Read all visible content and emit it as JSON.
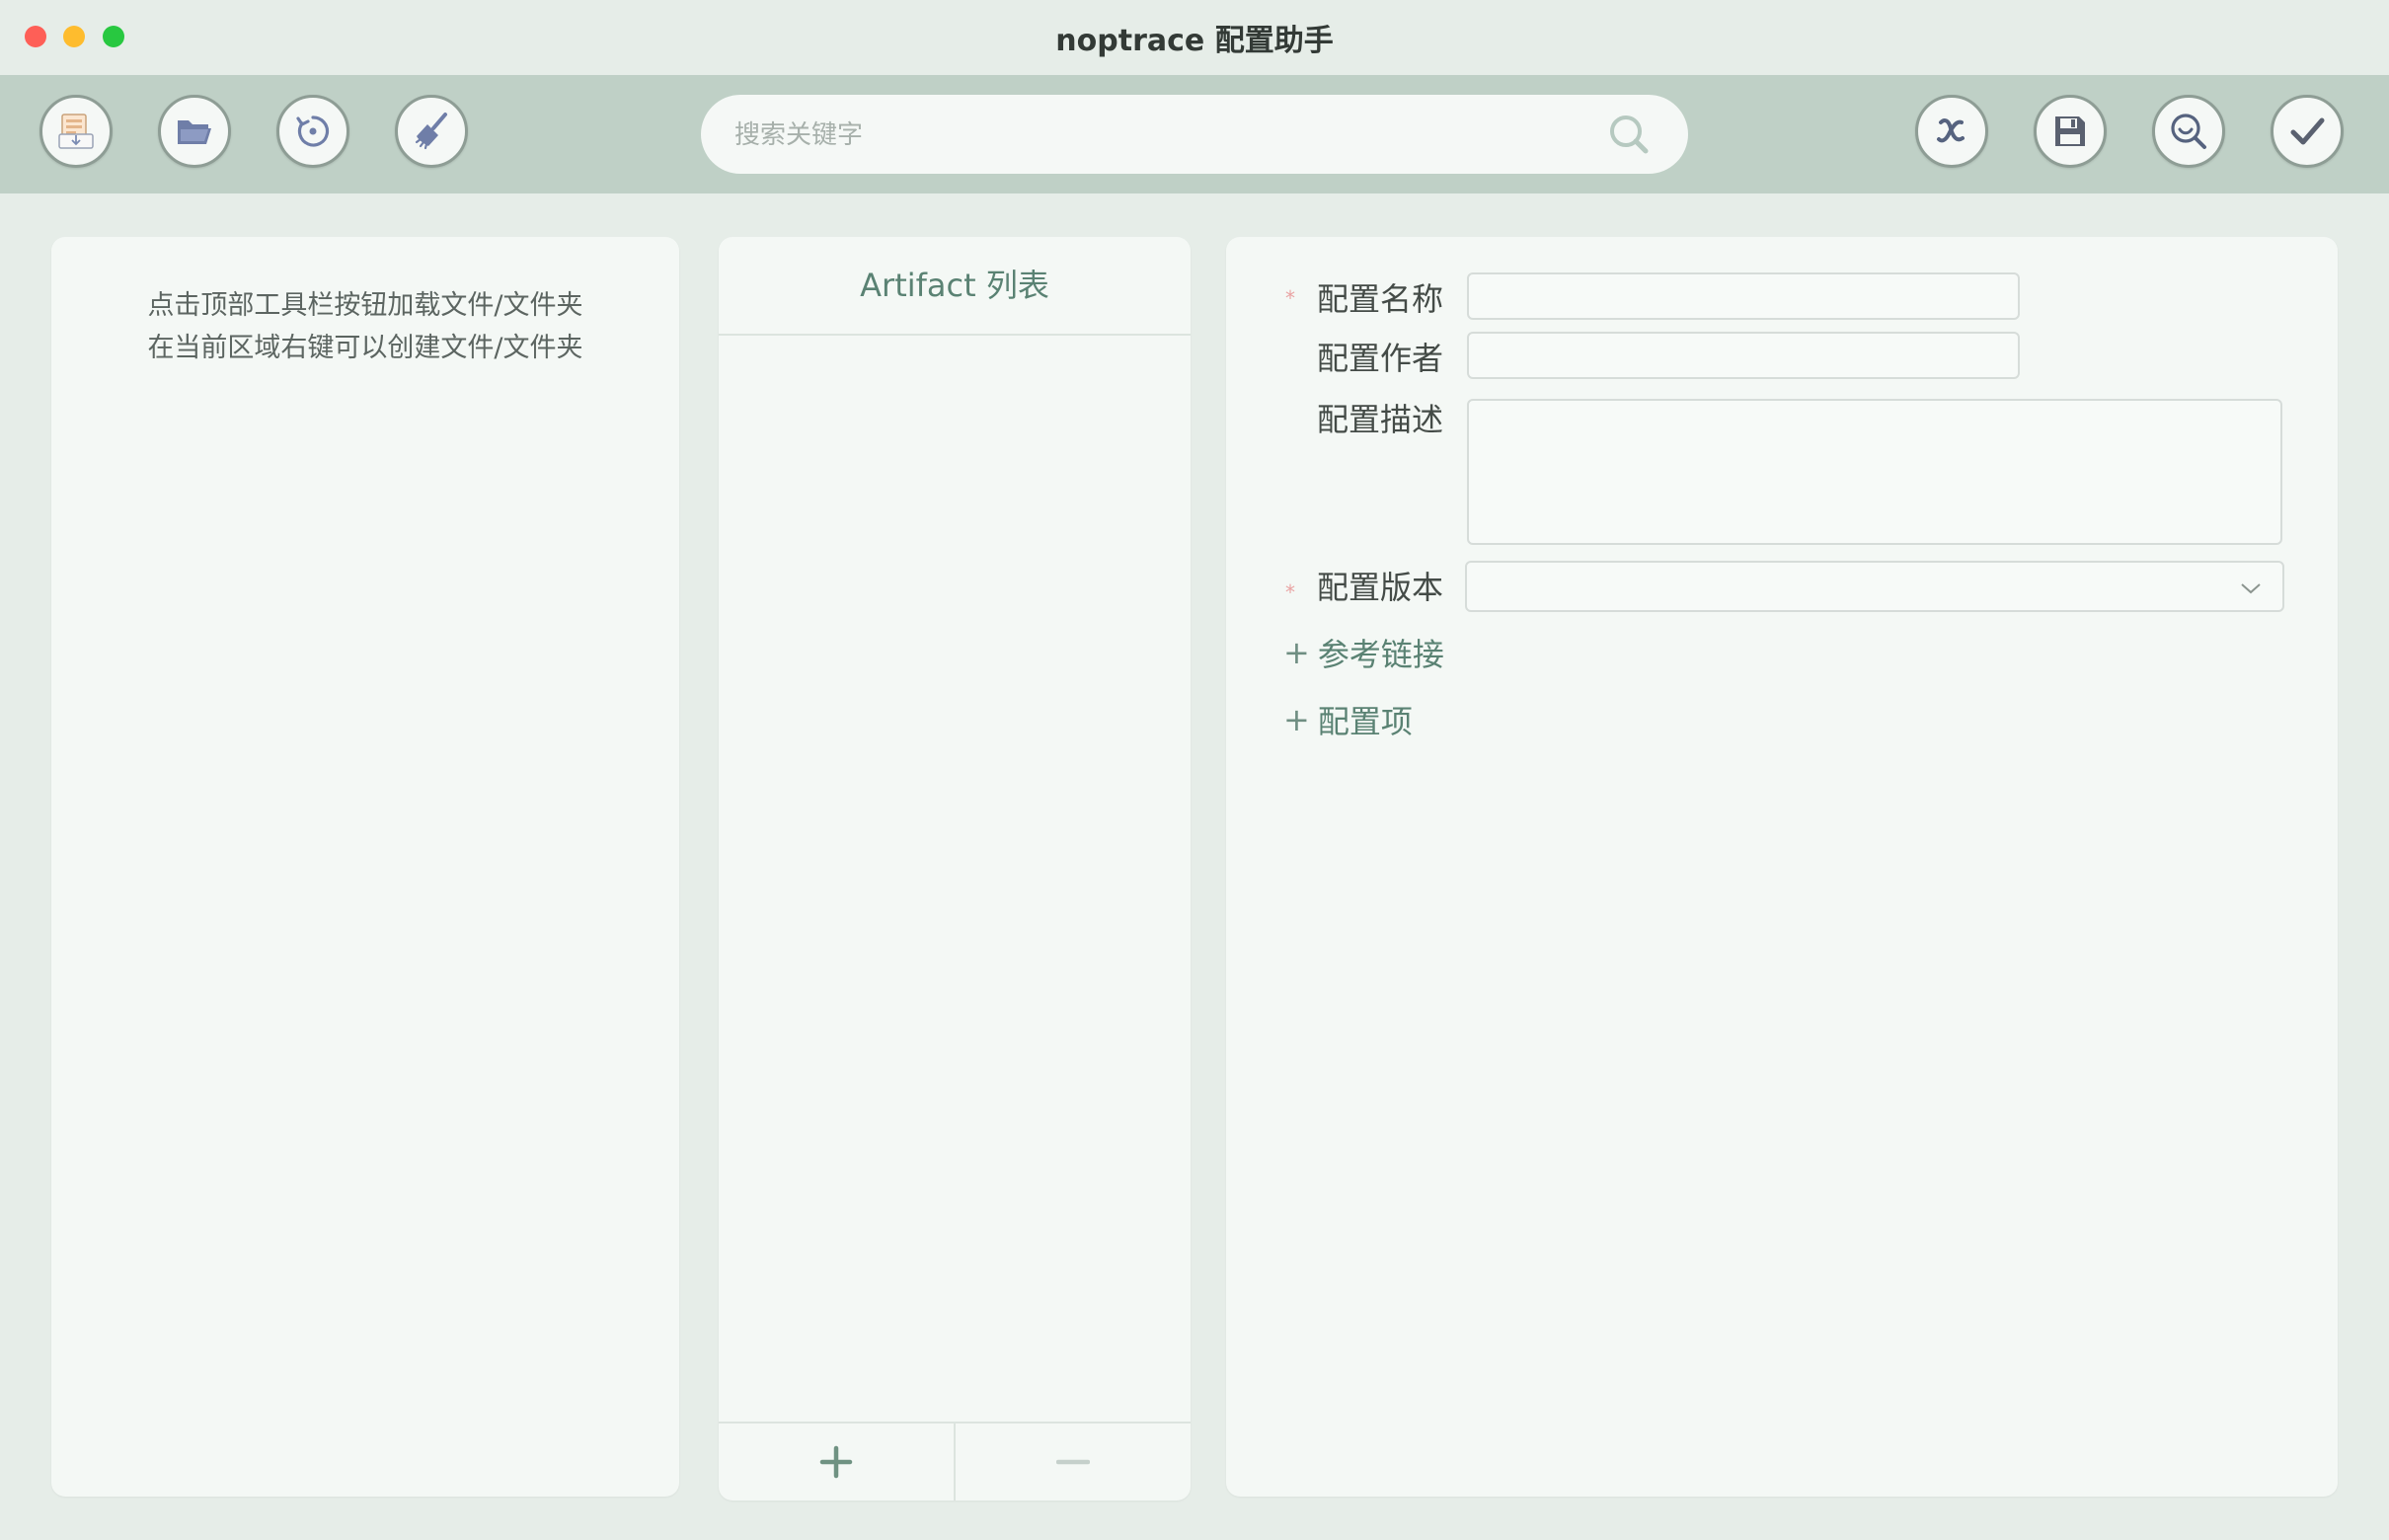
{
  "window": {
    "title": "noptrace 配置助手"
  },
  "toolbar": {
    "search_placeholder": "搜索关键字",
    "left_buttons": [
      "import-file-icon",
      "open-folder-icon",
      "reload-icon",
      "clean-broom-icon"
    ],
    "right_buttons": [
      "variable-x-icon",
      "save-disk-icon",
      "preview-search-icon",
      "check-icon"
    ]
  },
  "left_panel": {
    "hint_line1": "点击顶部工具栏按钮加载文件/文件夹",
    "hint_line2": "在当前区域右键可以创建文件/文件夹"
  },
  "artifact_panel": {
    "title": "Artifact 列表",
    "add_icon": "plus-icon",
    "remove_icon": "minus-icon"
  },
  "form": {
    "required_mark": "*",
    "name_label": "配置名称",
    "author_label": "配置作者",
    "description_label": "配置描述",
    "version_label": "配置版本",
    "reference_links": "参考链接",
    "config_items": "配置项",
    "plus": "+"
  },
  "colors": {
    "toolbar_bg": "#bfd0c6",
    "panel_bg": "#f4f8f5",
    "accent": "#5a8273",
    "icon_blue": "#6f7ea8"
  }
}
